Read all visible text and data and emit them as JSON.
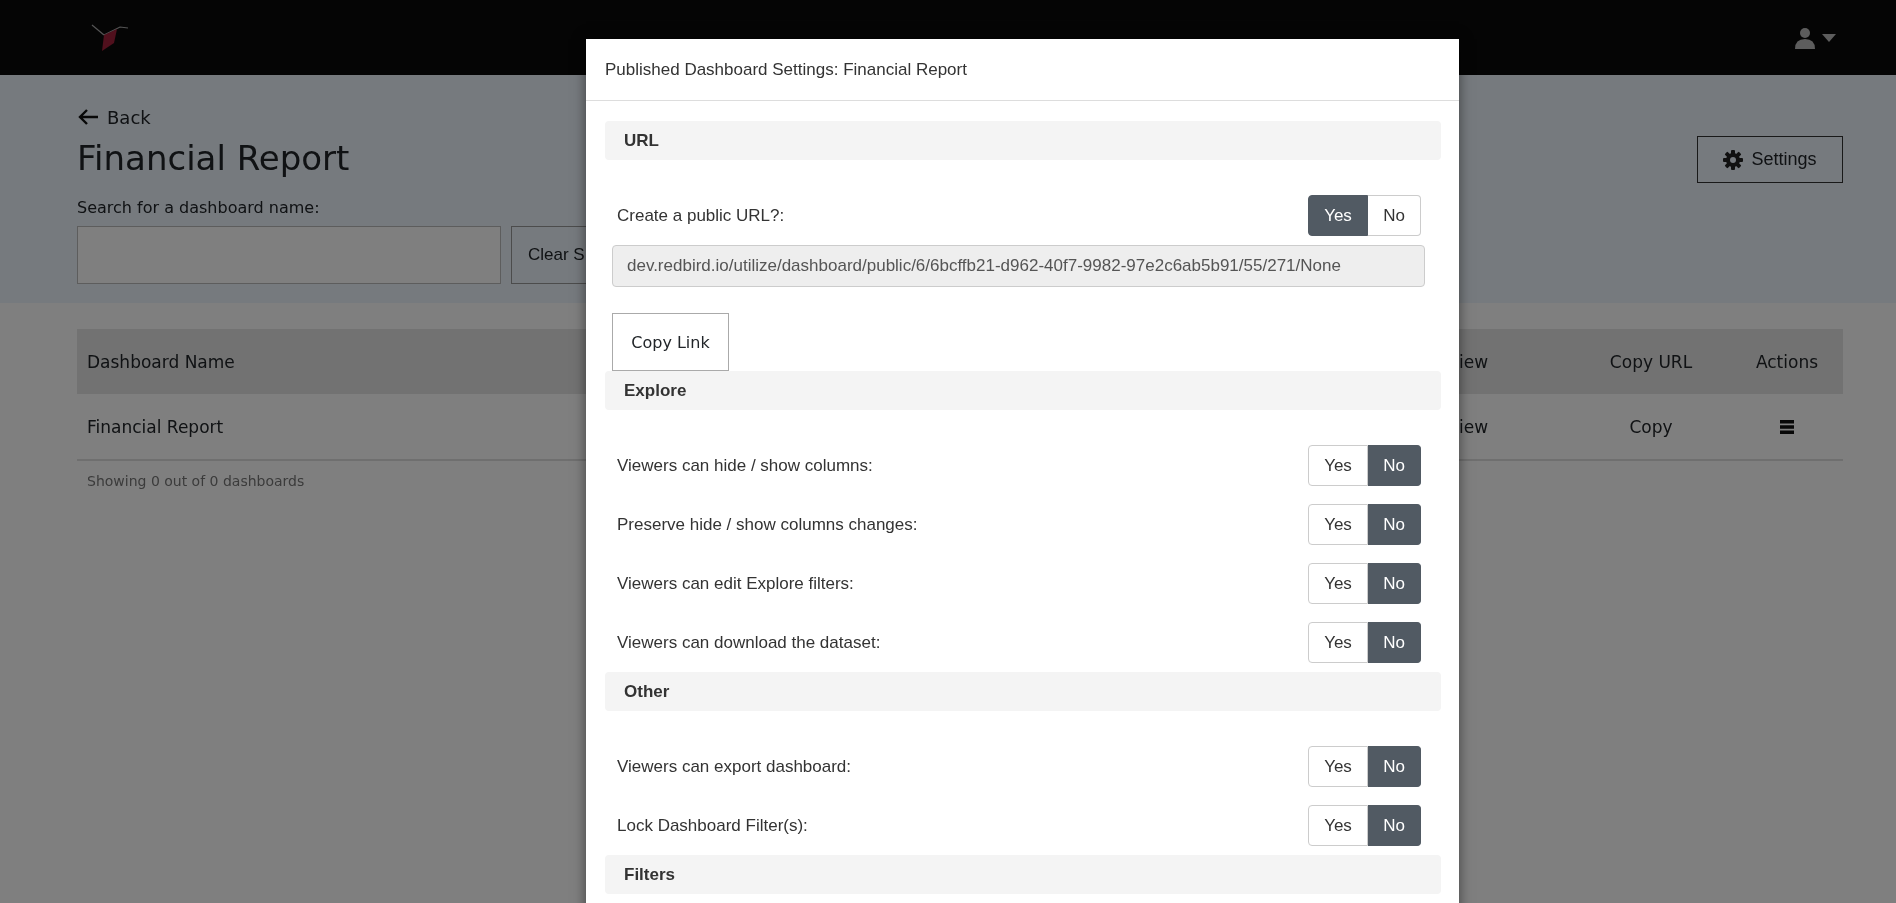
{
  "header": {
    "back": "Back",
    "title": "Financial Report",
    "settings_button": "Settings",
    "search": {
      "label": "Search for a dashboard name:"
    },
    "clear_button": "Clear S"
  },
  "table": {
    "columns": [
      "Dashboard Name",
      "iew",
      "Copy URL",
      "Actions"
    ],
    "rows": [
      {
        "cells": [
          "Financial Report",
          "iew",
          "Copy"
        ]
      }
    ],
    "footer": "Showing 0 out of 0 dashboards"
  },
  "modal": {
    "title": "Published Dashboard Settings: Financial Report",
    "sections": [
      {
        "title": "URL",
        "rows": [
          {
            "kind": "toggle",
            "label": "Create a public URL?:",
            "options": [
              {
                "label": "Yes",
                "selected": true
              },
              {
                "label": "No",
                "selected": false
              }
            ]
          },
          {
            "kind": "url",
            "value": "dev.redbird.io/utilize/dashboard/public/6/6bcffb21-d962-40f7-9982-97e2c6ab5b91/55/271/None"
          },
          {
            "kind": "button",
            "label": "Copy Link"
          }
        ]
      },
      {
        "title": "Explore",
        "rows": [
          {
            "kind": "toggle",
            "label": "Viewers can hide / show columns:",
            "options": [
              {
                "label": "Yes",
                "selected": false
              },
              {
                "label": "No",
                "selected": true
              }
            ]
          },
          {
            "kind": "toggle",
            "label": "Preserve hide / show columns changes:",
            "options": [
              {
                "label": "Yes",
                "selected": false
              },
              {
                "label": "No",
                "selected": true
              }
            ]
          },
          {
            "kind": "toggle",
            "label": "Viewers can edit Explore filters:",
            "options": [
              {
                "label": "Yes",
                "selected": false
              },
              {
                "label": "No",
                "selected": true
              }
            ]
          },
          {
            "kind": "toggle",
            "label": "Viewers can download the dataset:",
            "options": [
              {
                "label": "Yes",
                "selected": false
              },
              {
                "label": "No",
                "selected": true
              }
            ]
          }
        ]
      },
      {
        "title": "Other",
        "rows": [
          {
            "kind": "toggle",
            "label": "Viewers can export dashboard:",
            "options": [
              {
                "label": "Yes",
                "selected": false
              },
              {
                "label": "No",
                "selected": true
              }
            ]
          },
          {
            "kind": "toggle",
            "label": "Lock Dashboard Filter(s):",
            "options": [
              {
                "label": "Yes",
                "selected": false
              },
              {
                "label": "No",
                "selected": true
              }
            ]
          }
        ]
      },
      {
        "title": "Filters"
      }
    ]
  }
}
